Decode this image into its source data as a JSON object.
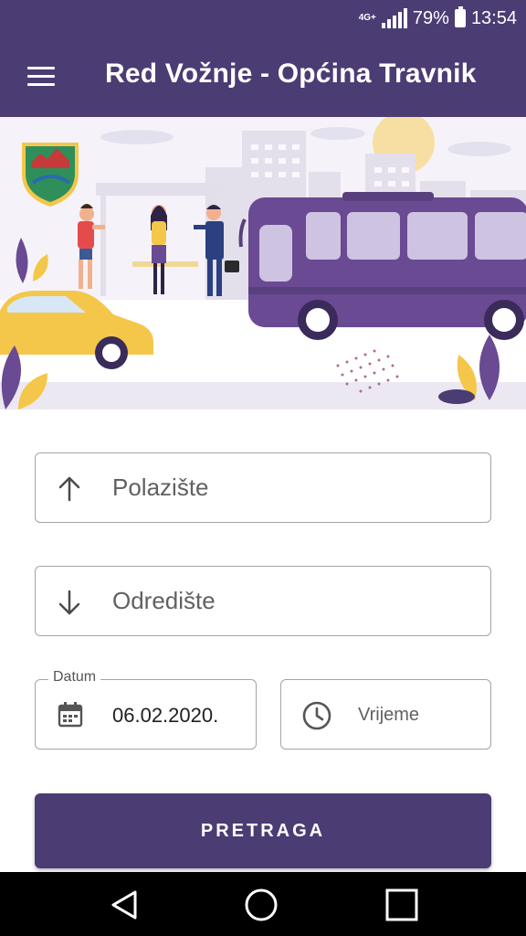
{
  "status_bar": {
    "network": "4G+",
    "battery": "79%",
    "time": "13:54"
  },
  "app_bar": {
    "title": "Red Vožnje - Općina Travnik"
  },
  "form": {
    "departure_placeholder": "Polazište",
    "destination_placeholder": "Odredište",
    "date_label": "Datum",
    "date_value": "06.02.2020.",
    "time_placeholder": "Vrijeme",
    "search_label": "PRETRAGA"
  },
  "icons": {
    "menu": "menu-icon",
    "departure": "arrow-up-icon",
    "destination": "arrow-down-icon",
    "date": "calendar-icon",
    "time": "clock-icon",
    "back": "back-triangle-icon",
    "home": "home-circle-icon",
    "recents": "recents-square-icon"
  },
  "colors": {
    "primary": "#4b3c74",
    "bus": "#6a4a92",
    "taxi": "#f4c64a",
    "sun": "#f7dfa4"
  }
}
